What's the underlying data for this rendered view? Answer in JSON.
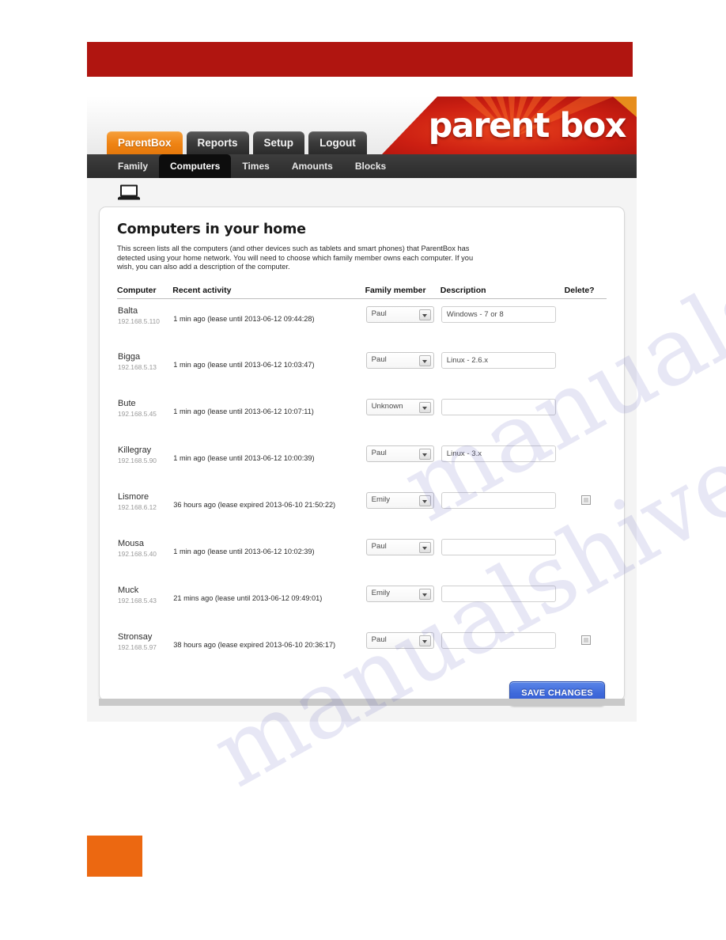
{
  "brand": {
    "logo_text": "parent box",
    "accent_red": "#b01510",
    "accent_orange": "#ec6811",
    "save_blue": "#3f6adb"
  },
  "nav": {
    "primary": [
      {
        "label": "ParentBox",
        "active": true
      },
      {
        "label": "Reports",
        "active": false
      },
      {
        "label": "Setup",
        "active": false
      },
      {
        "label": "Logout",
        "active": false
      }
    ],
    "secondary": [
      {
        "label": "Family",
        "active": false
      },
      {
        "label": "Computers",
        "active": true
      },
      {
        "label": "Times",
        "active": false
      },
      {
        "label": "Amounts",
        "active": false
      },
      {
        "label": "Blocks",
        "active": false
      }
    ]
  },
  "panel": {
    "icon": "laptop-icon",
    "title": "Computers in your home",
    "intro": "This screen lists all the computers (and other devices such as tablets and smart phones) that ParentBox has detected using your home network. You will need to choose which family member owns each computer. If you wish, you can also add a description of the computer."
  },
  "table": {
    "headers": {
      "computer": "Computer",
      "activity": "Recent activity",
      "family": "Family member",
      "description": "Description",
      "delete": "Delete?"
    },
    "rows": [
      {
        "name": "Balta",
        "ip": "192.168.5.110",
        "activity": "1 min ago (lease until 2013-06-12 09:44:28)",
        "family_member": "Paul",
        "description": "Windows - 7 or 8",
        "delete_visible": false
      },
      {
        "name": "Bigga",
        "ip": "192.168.5.13",
        "activity": "1 min ago (lease until 2013-06-12 10:03:47)",
        "family_member": "Paul",
        "description": "Linux - 2.6.x",
        "delete_visible": false
      },
      {
        "name": "Bute",
        "ip": "192.168.5.45",
        "activity": "1 min ago (lease until 2013-06-12 10:07:11)",
        "family_member": "Unknown",
        "description": "",
        "delete_visible": false
      },
      {
        "name": "Killegray",
        "ip": "192.168.5.90",
        "activity": "1 min ago (lease until 2013-06-12 10:00:39)",
        "family_member": "Paul",
        "description": "Linux - 3.x",
        "delete_visible": false
      },
      {
        "name": "Lismore",
        "ip": "192.168.6.12",
        "activity": "36 hours ago (lease expired 2013-06-10 21:50:22)",
        "family_member": "Emily",
        "description": "",
        "delete_visible": true
      },
      {
        "name": "Mousa",
        "ip": "192.168.5.40",
        "activity": "1 min ago (lease until 2013-06-12 10:02:39)",
        "family_member": "Paul",
        "description": "",
        "delete_visible": false
      },
      {
        "name": "Muck",
        "ip": "192.168.5.43",
        "activity": "21 mins ago (lease until 2013-06-12 09:49:01)",
        "family_member": "Emily",
        "description": "",
        "delete_visible": false
      },
      {
        "name": "Stronsay",
        "ip": "192.168.5.97",
        "activity": "38 hours ago (lease expired 2013-06-10 20:36:17)",
        "family_member": "Paul",
        "description": "",
        "delete_visible": true
      }
    ]
  },
  "actions": {
    "save_label": "SAVE CHANGES"
  },
  "watermark": {
    "line1": "manualshive.com",
    "line2": "manualshive.com"
  }
}
